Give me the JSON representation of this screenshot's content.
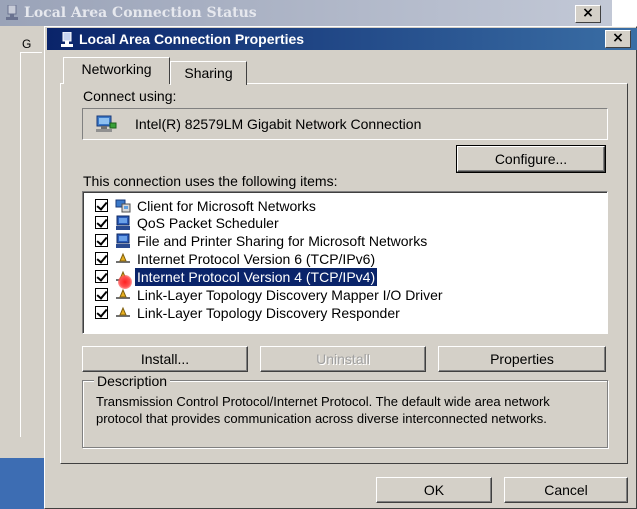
{
  "background_window": {
    "title": "Local Area Connection Status",
    "tab_fragment": "G",
    "close_glyph": "×"
  },
  "window": {
    "title": "Local Area Connection Properties",
    "close_glyph": "×"
  },
  "tabs": [
    {
      "label": "Networking",
      "active": true
    },
    {
      "label": "Sharing",
      "active": false
    }
  ],
  "connect_using": {
    "label": "Connect using:",
    "adapter_name": "Intel(R) 82579LM Gigabit Network Connection",
    "icon": "network-adapter-icon"
  },
  "buttons": {
    "configure": "Configure...",
    "install": "Install...",
    "uninstall": "Uninstall",
    "properties": "Properties",
    "ok": "OK",
    "cancel": "Cancel"
  },
  "items_label": "This connection uses the following items:",
  "items": [
    {
      "label": "Client for Microsoft Networks",
      "checked": true,
      "icon": "network-client-icon",
      "selected": false
    },
    {
      "label": "QoS Packet Scheduler",
      "checked": true,
      "icon": "computer-service-icon",
      "selected": false
    },
    {
      "label": "File and Printer Sharing for Microsoft Networks",
      "checked": true,
      "icon": "computer-service-icon",
      "selected": false
    },
    {
      "label": "Internet Protocol Version 6 (TCP/IPv6)",
      "checked": true,
      "icon": "protocol-icon",
      "selected": false
    },
    {
      "label": "Internet Protocol Version 4 (TCP/IPv4)",
      "checked": true,
      "icon": "protocol-icon",
      "selected": true
    },
    {
      "label": "Link-Layer Topology Discovery Mapper I/O Driver",
      "checked": true,
      "icon": "protocol-icon",
      "selected": false
    },
    {
      "label": "Link-Layer Topology Discovery Responder",
      "checked": true,
      "icon": "protocol-icon",
      "selected": false
    }
  ],
  "description": {
    "title": "Description",
    "text": "Transmission Control Protocol/Internet Protocol. The default wide area network protocol that provides communication across diverse interconnected networks."
  },
  "colors": {
    "titlebar_active": "#0a246a",
    "selection": "#0a246a",
    "dialog_face": "#d4d0c8"
  }
}
